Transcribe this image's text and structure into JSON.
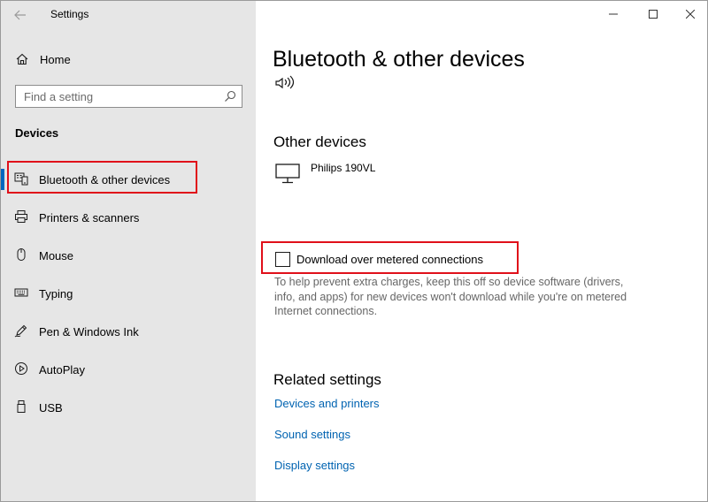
{
  "window": {
    "title": "Settings"
  },
  "sidebar": {
    "home_label": "Home",
    "search_placeholder": "Find a setting",
    "section_title": "Devices",
    "items": [
      {
        "label": "Bluetooth & other devices",
        "icon": "bluetooth-devices-icon",
        "selected": true
      },
      {
        "label": "Printers & scanners",
        "icon": "printer-icon",
        "selected": false
      },
      {
        "label": "Mouse",
        "icon": "mouse-icon",
        "selected": false
      },
      {
        "label": "Typing",
        "icon": "keyboard-icon",
        "selected": false
      },
      {
        "label": "Pen & Windows Ink",
        "icon": "pen-icon",
        "selected": false
      },
      {
        "label": "AutoPlay",
        "icon": "autoplay-icon",
        "selected": false
      },
      {
        "label": "USB",
        "icon": "usb-icon",
        "selected": false
      }
    ]
  },
  "main": {
    "page_title": "Bluetooth & other devices",
    "other_devices_title": "Other devices",
    "devices": [
      {
        "name": "Philips 190VL",
        "icon": "monitor-icon"
      }
    ],
    "metered": {
      "label": "Download over metered connections",
      "checked": false,
      "help": "To help prevent extra charges, keep this off so device software (drivers, info, and apps) for new devices won't download while you're on metered Internet connections."
    },
    "related_title": "Related settings",
    "related_links": [
      "Devices and printers",
      "Sound settings",
      "Display settings"
    ]
  },
  "colors": {
    "accent": "#0067c0",
    "link": "#0063b1",
    "highlight": "#e0101a",
    "sidebar_bg": "#e6e6e6"
  }
}
